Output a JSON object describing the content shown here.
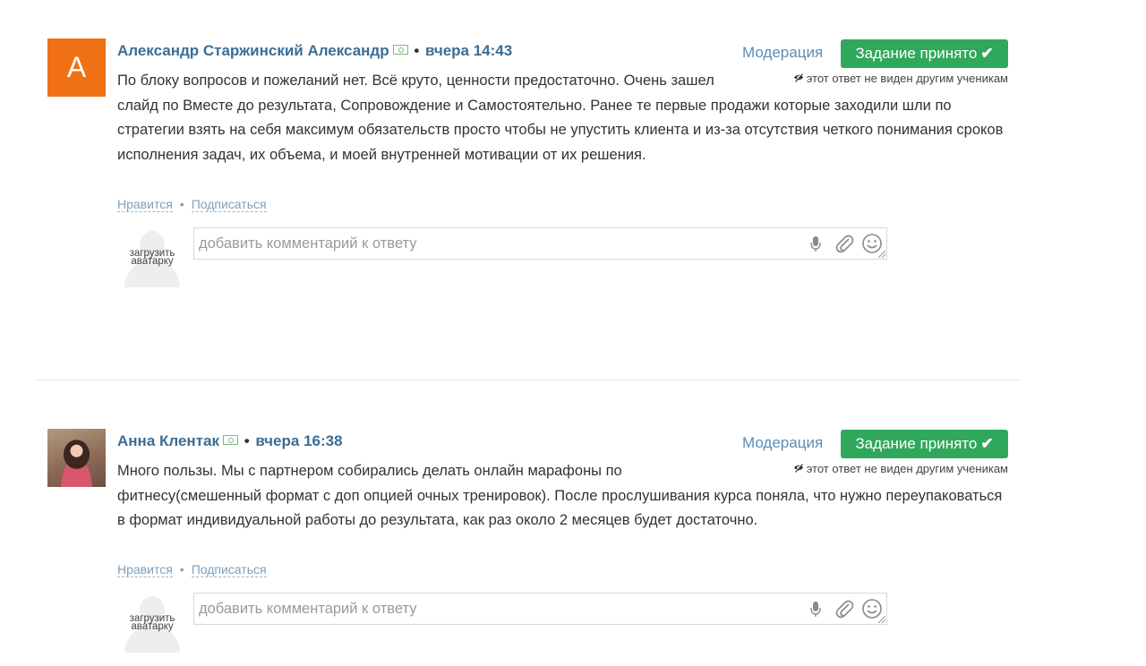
{
  "answers": [
    {
      "avatar_letter": "A",
      "author": "Александр Старжинский Александр",
      "time": "вчера 14:43",
      "moderation_label": "Модерация",
      "accept_label": "Задание принято",
      "hidden_note": "этот ответ не виден другим ученикам",
      "text": "По блоку вопросов и пожеланий нет. Всё круто, ценности предостаточно. Очень зашел слайд по Вместе до результата, Сопровождение и Самостоятельно. Ранее те первые продажи которые заходили шли по стратегии взять на себя максимум обязательств просто чтобы не упустить клиента и из-за отсутствия четкого понимания сроков исполнения задач, их объема, и моей внутренней мотивации от их решения.",
      "like_label": "Нравится",
      "subscribe_label": "Подписаться",
      "upload_avatar_label": "загрузить аватарку",
      "comment_placeholder": "добавить комментарий к ответу"
    },
    {
      "author": "Анна Клентак",
      "time": "вчера 16:38",
      "moderation_label": "Модерация",
      "accept_label": "Задание принято",
      "hidden_note": "этот ответ не виден другим ученикам",
      "text": "Много пользы. Мы с партнером собирались делать онлайн марафоны по фитнесу(смешенный формат с доп опцией очных тренировок). После прослушивания курса поняла, что нужно переупаковаться в формат индивидуальной работы до результата, как раз около 2 месяцев будет достаточно.",
      "like_label": "Нравится",
      "subscribe_label": "Подписаться",
      "upload_avatar_label": "загрузить аватарку",
      "comment_placeholder": "добавить комментарий к ответу"
    }
  ],
  "separator": "•",
  "check_mark": "✔",
  "icons": {
    "cash": "cash-icon",
    "eye": "eye-crossed-icon",
    "mic": "microphone-icon",
    "clip": "paperclip-icon",
    "smile": "smiley-icon"
  },
  "colors": {
    "accent_blue": "#3b6d95",
    "accept_green": "#30a85b",
    "avatar_orange": "#f07114"
  }
}
